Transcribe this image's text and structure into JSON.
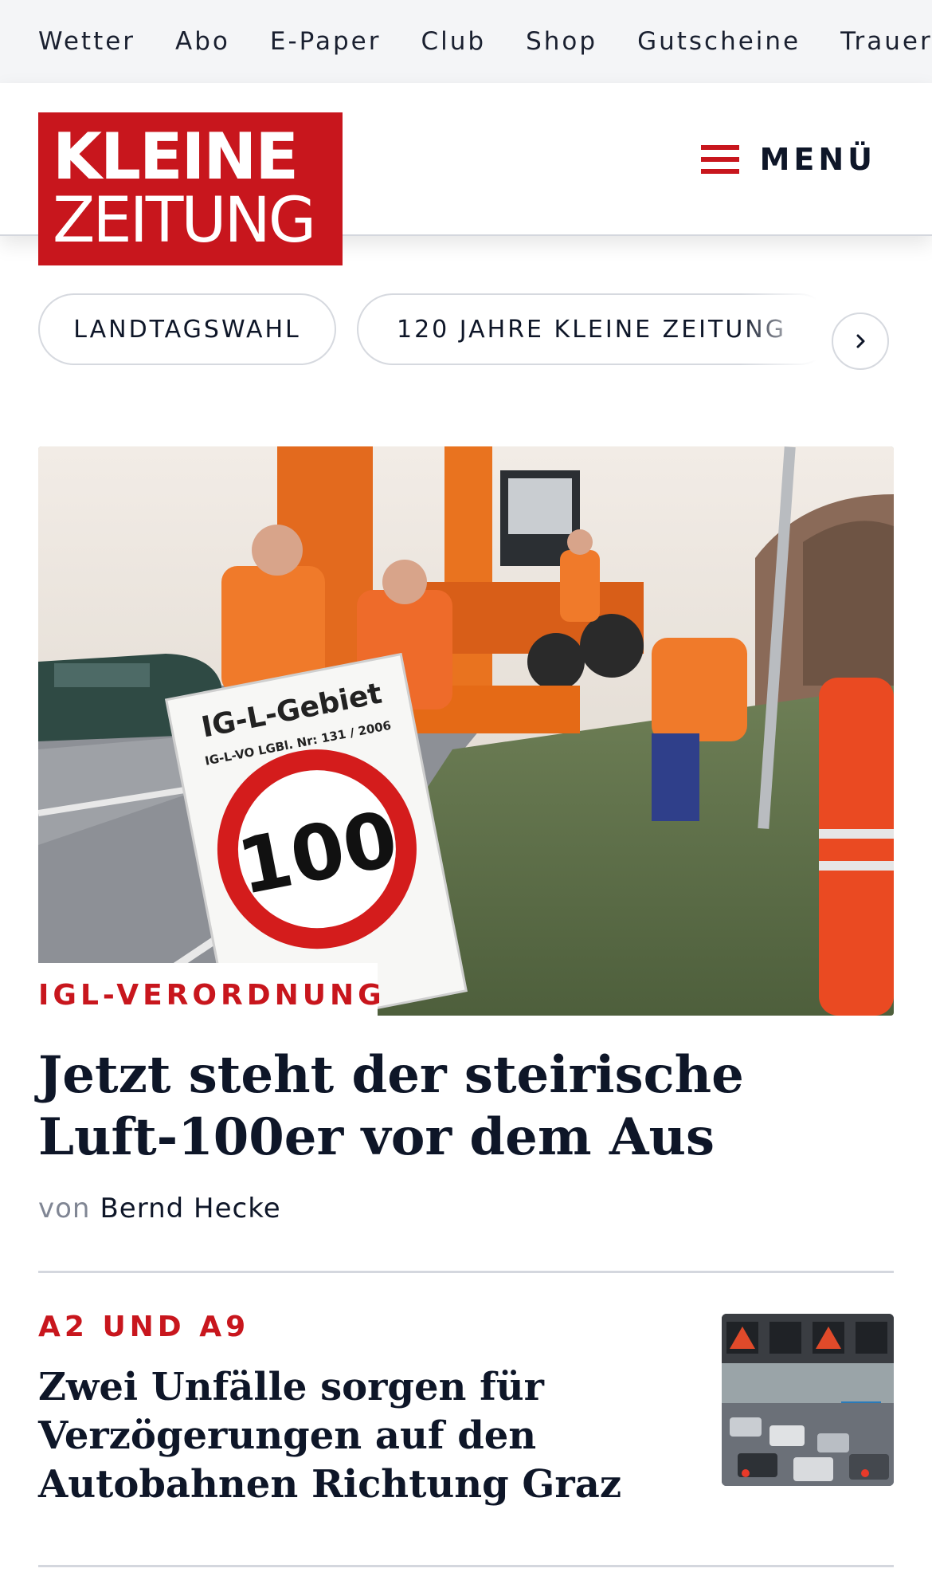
{
  "topbar": {
    "items": [
      "Wetter",
      "Abo",
      "E-Paper",
      "Club",
      "Shop",
      "Gutscheine",
      "Traueranzeigen"
    ]
  },
  "header": {
    "logo_line1": "KLEINE",
    "logo_line2": "ZEITUNG",
    "menu_label": "MENÜ",
    "brand_color": "#c8161d"
  },
  "topics": {
    "pills": [
      "LANDTAGSWAHL",
      "120 JAHRE KLEINE ZEITUNG"
    ],
    "next_icon": "chevron-right-icon"
  },
  "lead": {
    "sign_line1": "IG-L-Gebiet",
    "sign_line2": "IG-L-VO LGBl. Nr: 131 / 2006",
    "sign_speed": "100",
    "kicker": "IGL-VERORDNUNG",
    "title": "Jetzt steht der steirische Luft-100er vor dem Aus",
    "byline_prefix": "von",
    "author": "Bernd Hecke"
  },
  "articles": [
    {
      "kicker": "A2 UND A9",
      "title": "Zwei Unfälle sorgen für Verzögerungen auf den Autobahnen Richtung Graz"
    }
  ]
}
